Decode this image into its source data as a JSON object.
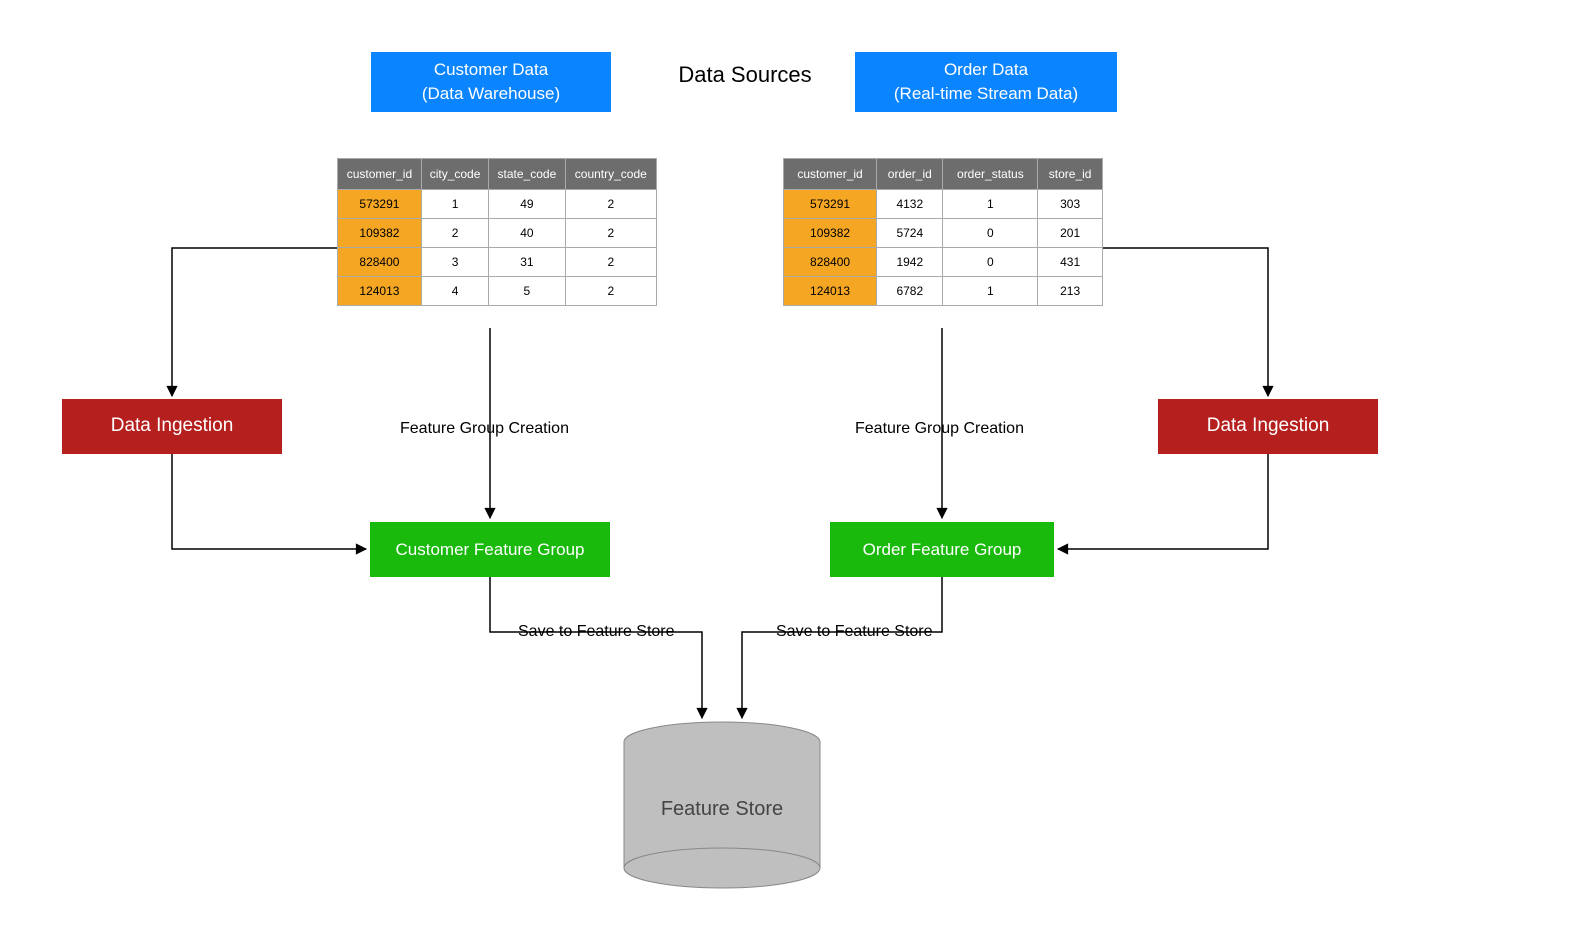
{
  "title": "Data Sources",
  "blocks": {
    "customer_source": {
      "line1": "Customer Data",
      "line2": "(Data Warehouse)"
    },
    "order_source": {
      "line1": "Order Data",
      "line2": "(Real-time Stream Data)"
    },
    "ingestion_left": "Data Ingestion",
    "ingestion_right": "Data Ingestion",
    "customer_fg": "Customer Feature Group",
    "order_fg": "Order Feature Group",
    "feature_store": "Feature Store"
  },
  "labels": {
    "fg_creation_left": "Feature Group Creation",
    "fg_creation_right": "Feature Group Creation",
    "save_left": "Save to Feature Store",
    "save_right": "Save to Feature Store"
  },
  "tables": {
    "customer": {
      "headers": [
        "customer_id",
        "city_code",
        "state_code",
        "country_code"
      ],
      "rows": [
        [
          "573291",
          "1",
          "49",
          "2"
        ],
        [
          "109382",
          "2",
          "40",
          "2"
        ],
        [
          "828400",
          "3",
          "31",
          "2"
        ],
        [
          "124013",
          "4",
          "5",
          "2"
        ]
      ]
    },
    "order": {
      "headers": [
        "customer_id",
        "order_id",
        "order_status",
        "store_id"
      ],
      "rows": [
        [
          "573291",
          "4132",
          "1",
          "303"
        ],
        [
          "109382",
          "5724",
          "0",
          "201"
        ],
        [
          "828400",
          "1942",
          "0",
          "431"
        ],
        [
          "124013",
          "6782",
          "1",
          "213"
        ]
      ]
    }
  }
}
